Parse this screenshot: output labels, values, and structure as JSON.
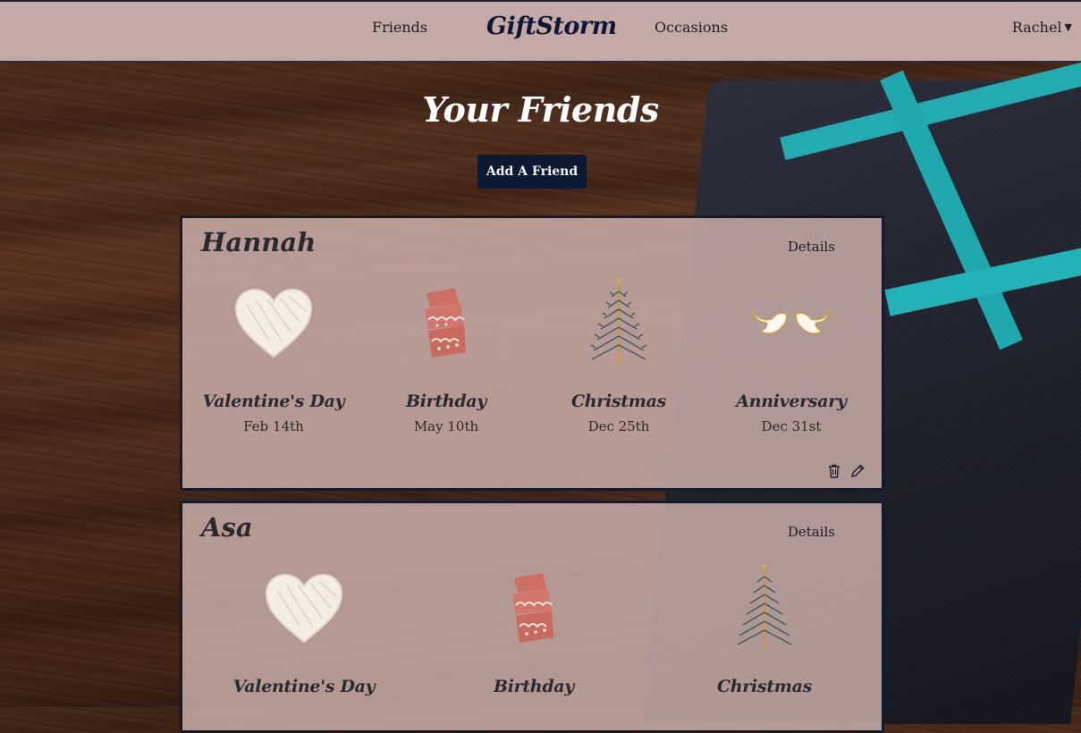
{
  "navbar": {
    "brand": "GiftStorm",
    "links": [
      "Friends",
      "Occasions"
    ],
    "user": "Rachel"
  },
  "page": {
    "title": "Your Friends",
    "add_button": "Add A Friend"
  },
  "friends": [
    {
      "name": "Hannah",
      "details_label": "Details",
      "occasions": [
        {
          "name": "Valentine's Day",
          "date": "Feb 14th",
          "icon": "heart-icon"
        },
        {
          "name": "Birthday",
          "date": "May 10th",
          "icon": "cake-icon"
        },
        {
          "name": "Christmas",
          "date": "Dec 25th",
          "icon": "tree-icon"
        },
        {
          "name": "Anniversary",
          "date": "Dec 31st",
          "icon": "doves-icon"
        }
      ]
    },
    {
      "name": "Asa",
      "details_label": "Details",
      "occasions": [
        {
          "name": "Valentine's Day",
          "icon": "heart-icon"
        },
        {
          "name": "Birthday",
          "icon": "cake-icon"
        },
        {
          "name": "Christmas",
          "icon": "tree-icon"
        }
      ]
    }
  ],
  "colors": {
    "navbar_bg": "#c4aaa7",
    "brand": "#0f1736",
    "button_bg": "#0d1a33",
    "card_border": "#141a2c"
  }
}
